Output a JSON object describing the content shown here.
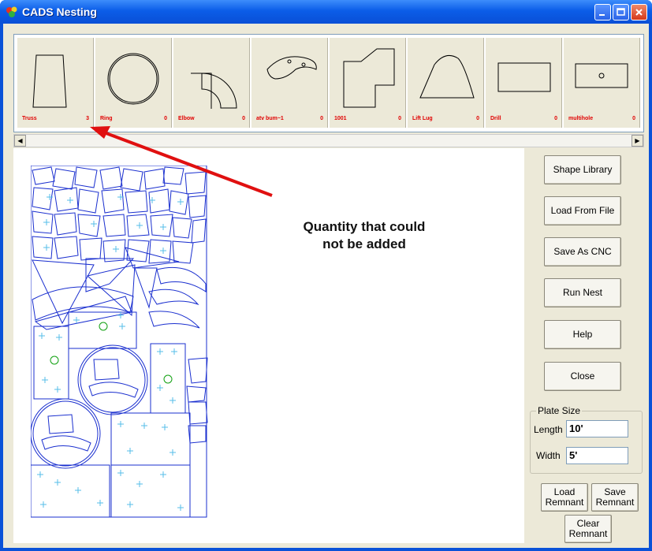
{
  "window": {
    "title": "CADS Nesting"
  },
  "colors": {
    "title_bar": "#0a52d8",
    "shape_label": "#e00000",
    "nest_outline": "#1a2fcf",
    "hole_marker": "#55bde8",
    "annotation_arrow": "#e01010"
  },
  "shape_library": [
    {
      "name": "Truss",
      "qty": "3",
      "icon": "truss-outline"
    },
    {
      "name": "Ring",
      "qty": "0",
      "icon": "ring-outline"
    },
    {
      "name": "Elbow",
      "qty": "0",
      "icon": "elbow-outline"
    },
    {
      "name": "atv bum~1",
      "qty": "0",
      "icon": "bumper-outline"
    },
    {
      "name": "1001",
      "qty": "0",
      "icon": "step-outline"
    },
    {
      "name": "Lift Lug",
      "qty": "0",
      "icon": "lift-lug-outline"
    },
    {
      "name": "Drill",
      "qty": "0",
      "icon": "rectangle-outline"
    },
    {
      "name": "multihole",
      "qty": "0",
      "icon": "plate-with-hole-outline"
    }
  ],
  "annotation": {
    "line1": "Quantity that could",
    "line2": "not be added"
  },
  "buttons": {
    "shape_library": "Shape Library",
    "load_from_file": "Load From File",
    "save_as_cnc": "Save As CNC",
    "run_nest": "Run Nest",
    "help": "Help",
    "close": "Close",
    "load_remnant_1": "Load",
    "load_remnant_2": "Remnant",
    "save_remnant_1": "Save",
    "save_remnant_2": "Remnant",
    "clear_remnant_1": "Clear",
    "clear_remnant_2": "Remnant"
  },
  "plate_size": {
    "title": "Plate Size",
    "length_label": "Length",
    "length_value": "10'",
    "width_label": "Width",
    "width_value": "5'"
  }
}
